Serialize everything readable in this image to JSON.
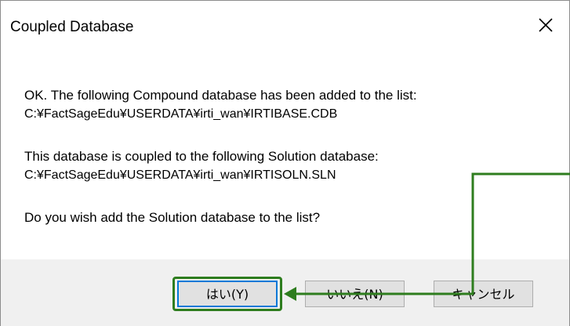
{
  "dialog": {
    "title": "Coupled Database",
    "close_icon": "close-icon"
  },
  "message": {
    "line1": "OK. The following Compound database has been added to the list:",
    "path1": "C:¥FactSageEdu¥USERDATA¥irti_wan¥IRTIBASE.CDB",
    "line2": "This database is coupled to the following Solution database:",
    "path2": "C:¥FactSageEdu¥USERDATA¥irti_wan¥IRTISOLN.SLN",
    "question": "Do you wish add the Solution database to the list?"
  },
  "buttons": {
    "yes_label": "はい(Y)",
    "no_label": "いいえ(N)",
    "cancel_label": "キャンセル"
  },
  "annotation": {
    "color": "#2e7d1e",
    "highlight": "yes-button"
  }
}
